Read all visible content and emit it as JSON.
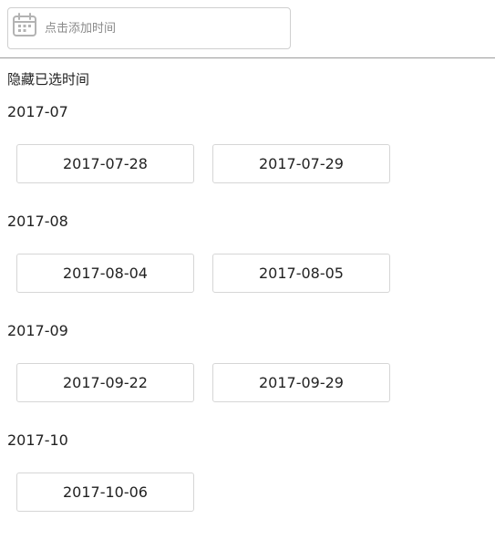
{
  "picker": {
    "icon": "calendar-icon",
    "placeholder": "点击添加时间",
    "icon_color": "#b3b3b3"
  },
  "hide_toggle_label": "隐藏已选时间",
  "groups": [
    {
      "month": "2017-07",
      "dates": [
        "2017-07-28",
        "2017-07-29"
      ]
    },
    {
      "month": "2017-08",
      "dates": [
        "2017-08-04",
        "2017-08-05"
      ]
    },
    {
      "month": "2017-09",
      "dates": [
        "2017-09-22",
        "2017-09-29"
      ]
    },
    {
      "month": "2017-10",
      "dates": [
        "2017-10-06"
      ]
    }
  ]
}
